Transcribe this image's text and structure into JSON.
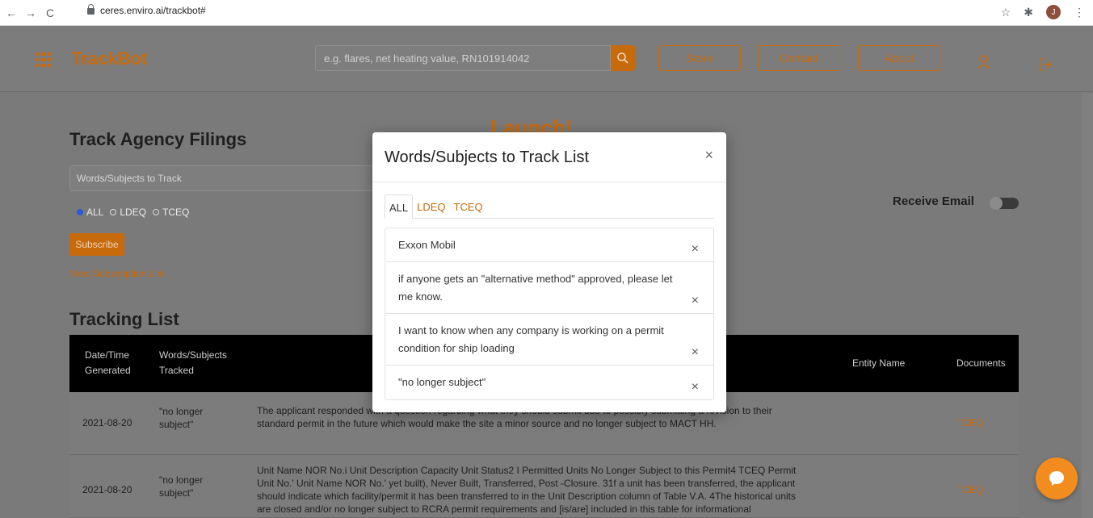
{
  "browser": {
    "url": "ceres.enviro.ai/trackbot#",
    "back_glyph": "←",
    "forward_glyph": "→",
    "reload_glyph": "C",
    "star_glyph": "☆",
    "extensions_glyph": "✱",
    "profile_initial": "J",
    "menu_glyph": "⋮"
  },
  "header": {
    "brand": "TrackBot",
    "search_placeholder": "e.g. flares, net heating value, RN101914042",
    "nav": [
      "Store",
      "Contact",
      "About"
    ]
  },
  "main": {
    "track_title": "Track Agency Filings",
    "launch_partial": "Launch!",
    "words_placeholder": "Words/Subjects to Track",
    "radios": [
      {
        "label": "ALL",
        "selected": true
      },
      {
        "label": "LDEQ",
        "selected": false
      },
      {
        "label": "TCEQ",
        "selected": false
      }
    ],
    "subscribe_label": "Subscribe",
    "subscription_link": "View Subscription List",
    "receive_email_label": "Receive Email",
    "tracking_title": "Tracking List"
  },
  "table": {
    "headers": {
      "date_line1": "Date/Time",
      "date_line2": "Generated",
      "words_line1": "Words/Subjects",
      "words_line2": "Tracked",
      "entity": "Entity Name",
      "documents": "Documents"
    },
    "rows": [
      {
        "date": "2021-08-20",
        "words_line1": "\"no longer",
        "words_line2": "subject\"",
        "text_lines": [
          "The applicant responded with a question regarding what they should submit due to possibly submitting a revision to their",
          "standard permit in the future which would make the site a minor source and no longer subject to MACT HH."
        ],
        "document": "TCEQ"
      },
      {
        "date": "2021-08-20",
        "words_line1": "\"no longer",
        "words_line2": "subject\"",
        "text_lines": [
          "Unit Name NOR No.i Unit Description Capacity Unit Status2 I Permitted Units No Longer Subject to this Permit4 TCEQ Permit",
          "Unit No.' Unit Name NOR No.' yet built), Never Built, Transferred, Post -Closure. 31f a unit has been transferred, the applicant",
          "should indicate which facility/permit it has been transferred to in the Unit Description column of Table V.A. 4The historical units",
          "are closed and/or no longer subject to RCRA permit requirements and [is/are] included in this table for informational"
        ],
        "document": "TCEQ"
      }
    ]
  },
  "modal": {
    "title": "Words/Subjects to Track List",
    "close_glyph": "×",
    "tabs": [
      "ALL",
      "LDEQ",
      "TCEQ"
    ],
    "active_tab": "ALL",
    "items": [
      {
        "lines": [
          "Exxon Mobil"
        ]
      },
      {
        "lines": [
          "if anyone gets an \"alternative method\" approved, please let",
          "me know."
        ]
      },
      {
        "lines": [
          "I want to know when any company is working on a permit",
          "condition for ship loading"
        ]
      },
      {
        "lines": [
          "\"no longer subject\""
        ]
      }
    ],
    "remove_glyph": "×"
  },
  "colors": {
    "accent": "#c76a0c",
    "chat": "#f28c1e",
    "overlay_bg": "#7a7a7a"
  },
  "icons": {
    "menu": "grid-menu-icon",
    "search": "search-icon",
    "user": "user-icon",
    "logout": "logout-icon",
    "chat": "chat-bubble-icon"
  }
}
